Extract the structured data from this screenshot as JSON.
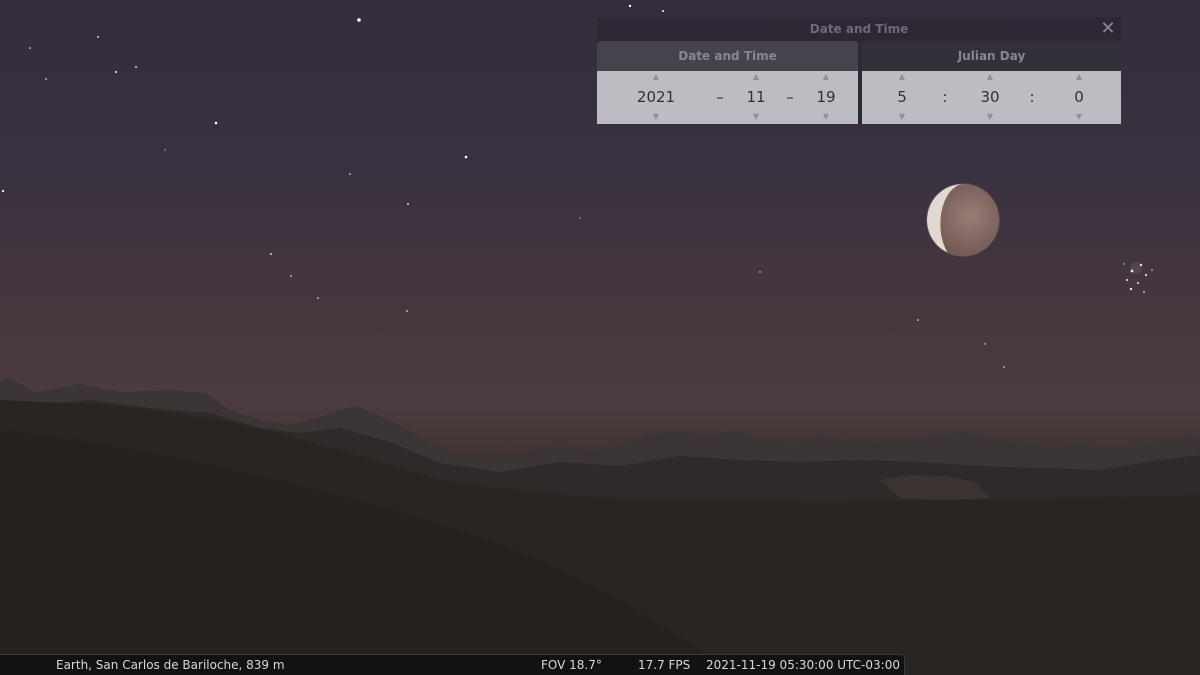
{
  "dialog": {
    "title": "Date and Time",
    "close_symbol": "✕",
    "tabs": [
      {
        "label": "Date and Time"
      },
      {
        "label": "Julian Day"
      }
    ],
    "date": {
      "year": "2021",
      "month": "11",
      "day": "19",
      "separator": "–"
    },
    "time": {
      "hour": "5",
      "minute": "30",
      "second": "0",
      "separator": ":"
    },
    "spin_up_symbol": "▲",
    "spin_down_symbol": "▼"
  },
  "status_bar": {
    "location": "Earth, San Carlos de Bariloche, 839 m",
    "fov": "FOV 18.7°",
    "fps": "17.7 FPS",
    "datetime": "2021-11-19 05:30:00 UTC-03:00"
  },
  "icons": {
    "close": "close-icon",
    "spin_up": "triangle-up-icon",
    "spin_down": "triangle-down-icon"
  },
  "colors": {
    "sky_top": "#332d3d",
    "horizon": "#4d3c3f",
    "ground": "#2c2622",
    "moon_lit": "#e4dad3",
    "moon_eclipsed": "#8a6e66"
  }
}
